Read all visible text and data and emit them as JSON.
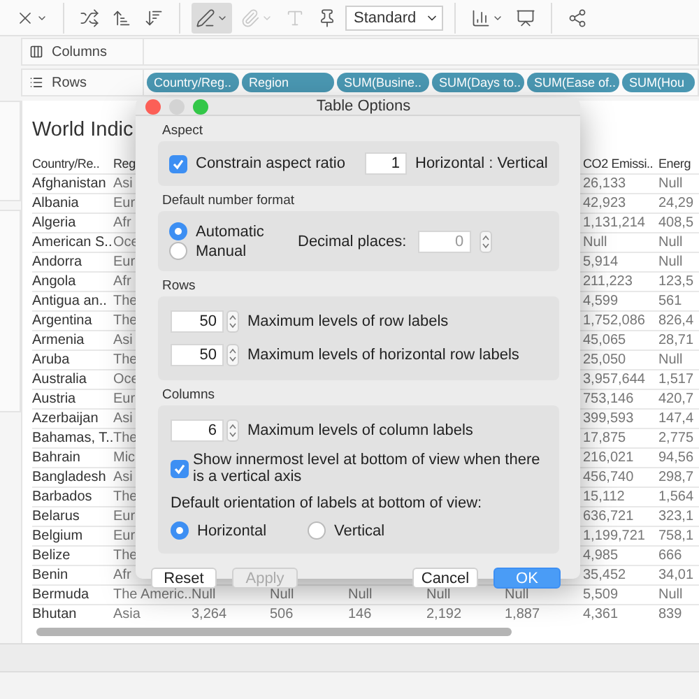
{
  "toolbar": {
    "groups": [
      {
        "items": [
          {
            "kind": "clear-chart",
            "selected": false,
            "disabled": false
          }
        ]
      },
      {
        "items": [
          {
            "kind": "swap",
            "selected": false,
            "disabled": false
          },
          {
            "kind": "sort-ascending",
            "selected": false,
            "disabled": false
          },
          {
            "kind": "sort-descending",
            "selected": false,
            "disabled": false
          }
        ]
      },
      {
        "items": [
          {
            "kind": "highlight",
            "selected": true,
            "disabled": false
          },
          {
            "kind": "group",
            "selected": false,
            "disabled": true
          },
          {
            "kind": "label",
            "selected": false,
            "disabled": true
          },
          {
            "kind": "pin",
            "selected": false,
            "disabled": false
          },
          {
            "kind": "fit",
            "value": "Standard",
            "selected": false,
            "disabled": false
          }
        ]
      },
      {
        "items": [
          {
            "kind": "show-cards",
            "selected": false,
            "disabled": false
          },
          {
            "kind": "presentation",
            "selected": false,
            "disabled": false
          }
        ]
      },
      {
        "items": [
          {
            "kind": "share",
            "selected": false,
            "disabled": false
          }
        ]
      }
    ]
  },
  "shelves": [
    {
      "kind": "columns",
      "label": "Columns"
    },
    {
      "kind": "rows",
      "label": "Rows",
      "pills": [
        "Country/Reg..",
        "Region",
        "SUM(Busine..",
        "SUM(Days to..",
        "SUM(Ease of..",
        "SUM(Hou"
      ]
    }
  ],
  "view": {
    "title": "World Indic",
    "table": {
      "columns": [
        "Country/Re..",
        "Reg",
        "CO2 Emissi..",
        "Energ"
      ],
      "rows": [
        {
          "country": "Afghanistan",
          "region": "Asi",
          "co2": "26,133",
          "energy": "Null"
        },
        {
          "country": "Albania",
          "region": "Eur",
          "co2": "42,923",
          "energy": "24,29"
        },
        {
          "country": "Algeria",
          "region": "Afr",
          "co2": "1,131,214",
          "energy": "408,5"
        },
        {
          "country": "American S..",
          "region": "Oce",
          "co2": "Null",
          "energy": "Null"
        },
        {
          "country": "Andorra",
          "region": "Eur",
          "co2": "5,914",
          "energy": "Null"
        },
        {
          "country": "Angola",
          "region": "Afr",
          "co2": "211,223",
          "energy": "123,5"
        },
        {
          "country": "Antigua an..",
          "region": "The",
          "co2": "4,599",
          "energy": "561"
        },
        {
          "country": "Argentina",
          "region": "The",
          "co2": "1,752,086",
          "energy": "826,4"
        },
        {
          "country": "Armenia",
          "region": "Asi",
          "co2": "45,065",
          "energy": "28,71"
        },
        {
          "country": "Aruba",
          "region": "The",
          "co2": "25,050",
          "energy": "Null"
        },
        {
          "country": "Australia",
          "region": "Oce",
          "co2": "3,957,644",
          "energy": "1,517"
        },
        {
          "country": "Austria",
          "region": "Eur",
          "co2": "753,146",
          "energy": "420,7"
        },
        {
          "country": "Azerbaijan",
          "region": "Asi",
          "co2": "399,593",
          "energy": "147,4"
        },
        {
          "country": "Bahamas, T..",
          "region": "The",
          "co2": "17,875",
          "energy": "2,775"
        },
        {
          "country": "Bahrain",
          "region": "Mic",
          "co2": "216,021",
          "energy": "94,56"
        },
        {
          "country": "Bangladesh",
          "region": "Asi",
          "co2": "456,740",
          "energy": "298,7"
        },
        {
          "country": "Barbados",
          "region": "The",
          "co2": "15,112",
          "energy": "1,564"
        },
        {
          "country": "Belarus",
          "region": "Eur",
          "co2": "636,721",
          "energy": "323,1"
        },
        {
          "country": "Belgium",
          "region": "Eur",
          "co2": "1,199,721",
          "energy": "758,1"
        },
        {
          "country": "Belize",
          "region": "The",
          "co2": "4,985",
          "energy": "666"
        },
        {
          "country": "Benin",
          "region": "Afr",
          "co2": "35,452",
          "energy": "34,01"
        },
        {
          "country": "Bermuda",
          "region": "The Americ..",
          "middle": [
            "Null",
            "Null",
            "Null",
            "Null",
            "Null"
          ],
          "co2": "5,509",
          "energy": "Null"
        },
        {
          "country": "Bhutan",
          "region": "Asia",
          "middle": [
            "3,264",
            "506",
            "146",
            "2,192",
            "1,887"
          ],
          "co2": "4,361",
          "energy": "839"
        }
      ]
    }
  },
  "dialog": {
    "title": "Table Options",
    "aspect": {
      "heading": "Aspect",
      "constrain": {
        "label": "Constrain aspect ratio",
        "checked": true
      },
      "ratio": "1",
      "ratio_label": "Horizontal : Vertical"
    },
    "number_format": {
      "heading": "Default number format",
      "options": [
        {
          "label": "Automatic",
          "selected": true
        },
        {
          "label": "Manual",
          "selected": false
        }
      ],
      "decimal_label": "Decimal places:",
      "decimal_value": "0",
      "decimal_disabled": true
    },
    "rows": {
      "heading": "Rows",
      "fields": [
        {
          "value": "50",
          "label": "Maximum levels of row labels"
        },
        {
          "value": "50",
          "label": "Maximum levels of horizontal row labels"
        }
      ]
    },
    "columns": {
      "heading": "Columns",
      "fields": [
        {
          "value": "6",
          "label": "Maximum levels of column labels"
        }
      ],
      "innermost": {
        "label": "Show innermost level at bottom of view when there is a vertical axis",
        "checked": true
      },
      "orientation_label": "Default orientation of labels at bottom of view:",
      "orientations": [
        {
          "label": "Horizontal",
          "selected": true
        },
        {
          "label": "Vertical",
          "selected": false
        }
      ]
    },
    "buttons": [
      {
        "label": "Reset",
        "kind": "normal",
        "disabled": false
      },
      {
        "label": "Apply",
        "kind": "normal",
        "disabled": true
      },
      {
        "label": "Cancel",
        "kind": "normal",
        "disabled": false
      },
      {
        "label": "OK",
        "kind": "primary",
        "disabled": false
      }
    ]
  }
}
